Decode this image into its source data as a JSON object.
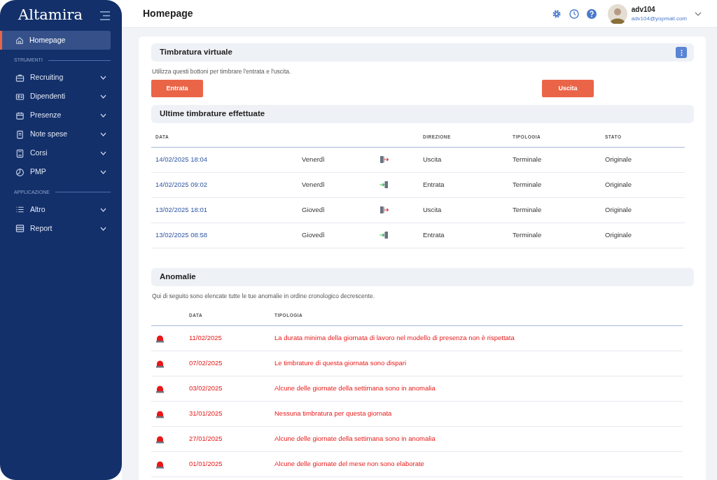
{
  "sidebar": {
    "logo": "Altamira",
    "home": {
      "label": "Homepage",
      "selected": true
    },
    "sections": [
      {
        "title": "STRUMENTI",
        "items": [
          {
            "label": "Recruiting",
            "expanded": false
          },
          {
            "label": "Dipendenti",
            "expanded": false
          },
          {
            "label": "Presenze",
            "expanded": false
          },
          {
            "label": "Note spese",
            "expanded": false
          },
          {
            "label": "Corsi",
            "expanded": false
          },
          {
            "label": "PMP",
            "expanded": false
          }
        ]
      },
      {
        "title": "APPLICAZIONE",
        "items": [
          {
            "label": "Altro",
            "expanded": false
          },
          {
            "label": "Report",
            "expanded": false
          }
        ]
      }
    ]
  },
  "header": {
    "title": "Homepage",
    "user": {
      "name": "adv104",
      "email": "adv104@yopmail.com"
    }
  },
  "clock_panel": {
    "title": "Timbratura virtuale",
    "description": "Utilizza questi bottoni per timbrare l'entrata e l'uscita.",
    "buttons": [
      "Entrata",
      "Uscita"
    ]
  },
  "punches": {
    "title": "Ultime timbrature effettuate",
    "columns": [
      "DATA",
      "DIREZIONE",
      "TIPOLOGIA",
      "STATO"
    ],
    "rows": [
      {
        "date": "14/02/2025 18:04",
        "day": "Venerdì",
        "kind": "out",
        "direction": "Uscita",
        "type": "Terminale",
        "status": "Originale"
      },
      {
        "date": "14/02/2025 09:02",
        "day": "Venerdì",
        "kind": "in",
        "direction": "Entrata",
        "type": "Terminale",
        "status": "Originale"
      },
      {
        "date": "13/02/2025 18:01",
        "day": "Giovedì",
        "kind": "out",
        "direction": "Uscita",
        "type": "Terminale",
        "status": "Originale"
      },
      {
        "date": "13/02/2025 08:58",
        "day": "Giovedì",
        "kind": "in",
        "direction": "Entrata",
        "type": "Terminale",
        "status": "Originale"
      }
    ]
  },
  "anomalies": {
    "title": "Anomalie",
    "description": "Qui di seguito sono elencate tutte le tue anomalie in ordine cronologico decrescente.",
    "columns": [
      "DATA",
      "TIPOLOGIA"
    ],
    "rows": [
      {
        "date": "11/02/2025",
        "description": "La durata minima della giornata di lavoro nel modello di presenza non è rispettata"
      },
      {
        "date": "07/02/2025",
        "description": "Le timbrature di questa giornata sono dispari"
      },
      {
        "date": "03/02/2025",
        "description": "Alcune delle giornate della settimana sono in anomalia"
      },
      {
        "date": "31/01/2025",
        "description": "Nessuna timbratura per questa giornata"
      },
      {
        "date": "27/01/2025",
        "description": "Alcune delle giornate della settimana sono in anomalia"
      },
      {
        "date": "01/01/2025",
        "description": "Alcune delle giornate del mese non sono elaborate"
      }
    ]
  }
}
